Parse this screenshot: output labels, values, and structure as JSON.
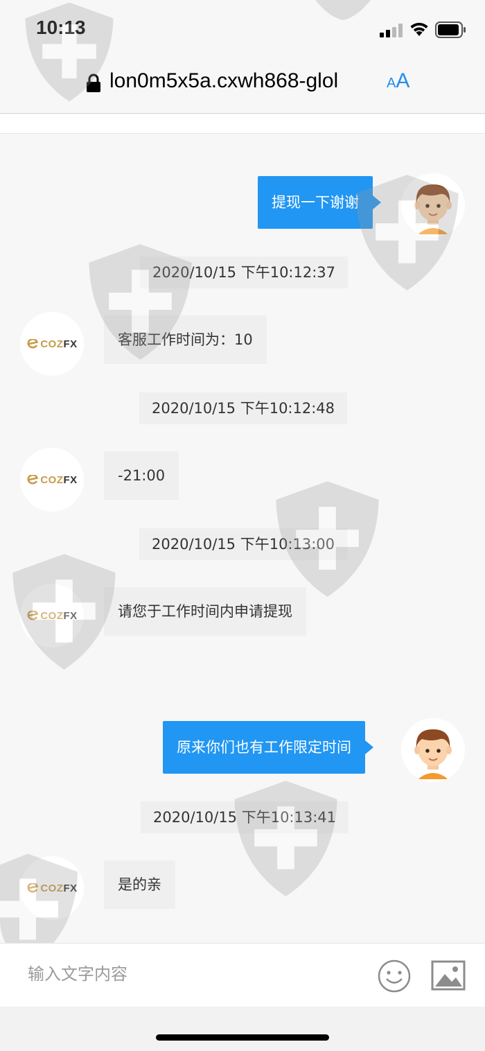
{
  "status_bar": {
    "time": "10:13"
  },
  "browser": {
    "url": "lon0m5x5a.cxwh868-glol",
    "text_size_small": "A",
    "text_size_large": "A"
  },
  "brand": {
    "name_left": "COZ",
    "name_right": "FX",
    "accent_color": "#c89a4a"
  },
  "messages": [
    {
      "type": "out",
      "text": "提现一下谢谢"
    },
    {
      "type": "timestamp",
      "text": "2020/10/15 下午10:12:37"
    },
    {
      "type": "in",
      "text": "客服工作时间为：10"
    },
    {
      "type": "timestamp",
      "text": "2020/10/15 下午10:12:48"
    },
    {
      "type": "in",
      "text": "-21:00"
    },
    {
      "type": "timestamp",
      "text": "2020/10/15 下午10:13:00"
    },
    {
      "type": "in",
      "text": "请您于工作时间内申请提现"
    },
    {
      "type": "out",
      "text": "原来你们也有工作限定时间"
    },
    {
      "type": "timestamp",
      "text": "2020/10/15 下午10:13:41"
    },
    {
      "type": "in",
      "text": "是的亲"
    }
  ],
  "composer": {
    "placeholder": "输入文字内容",
    "emoji_icon": "smiley-face-icon",
    "image_icon": "picture-icon"
  },
  "colors": {
    "outgoing_bubble": "#2196f3",
    "incoming_bubble": "#efefef",
    "link_blue": "#1f8ef1"
  }
}
